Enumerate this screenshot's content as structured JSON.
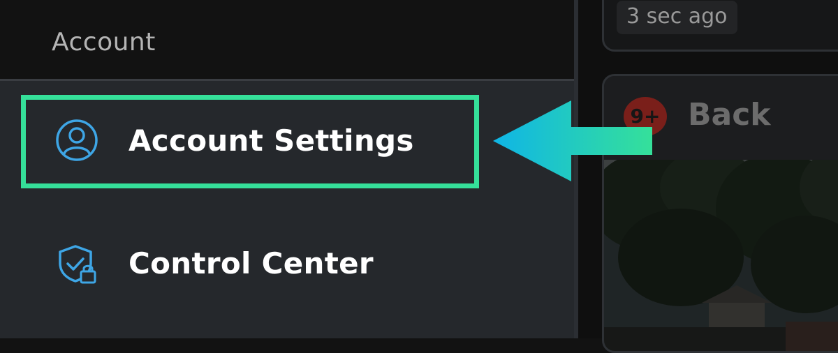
{
  "menu": {
    "section_title": "Account",
    "items": [
      {
        "label": "Account Settings",
        "icon": "user-circle-icon",
        "highlighted": true
      },
      {
        "label": "Control Center",
        "icon": "shield-lock-icon",
        "highlighted": false
      }
    ]
  },
  "right_pane": {
    "top_card": {
      "time_label": "3 sec ago"
    },
    "camera_card": {
      "badge": "9+",
      "title": "Back"
    }
  },
  "colors": {
    "highlight": "#35e09a",
    "icon_accent": "#3ea6e6",
    "arrow_start": "#35e09a",
    "arrow_end": "#0fb5e6",
    "badge": "#7a1f1a"
  }
}
